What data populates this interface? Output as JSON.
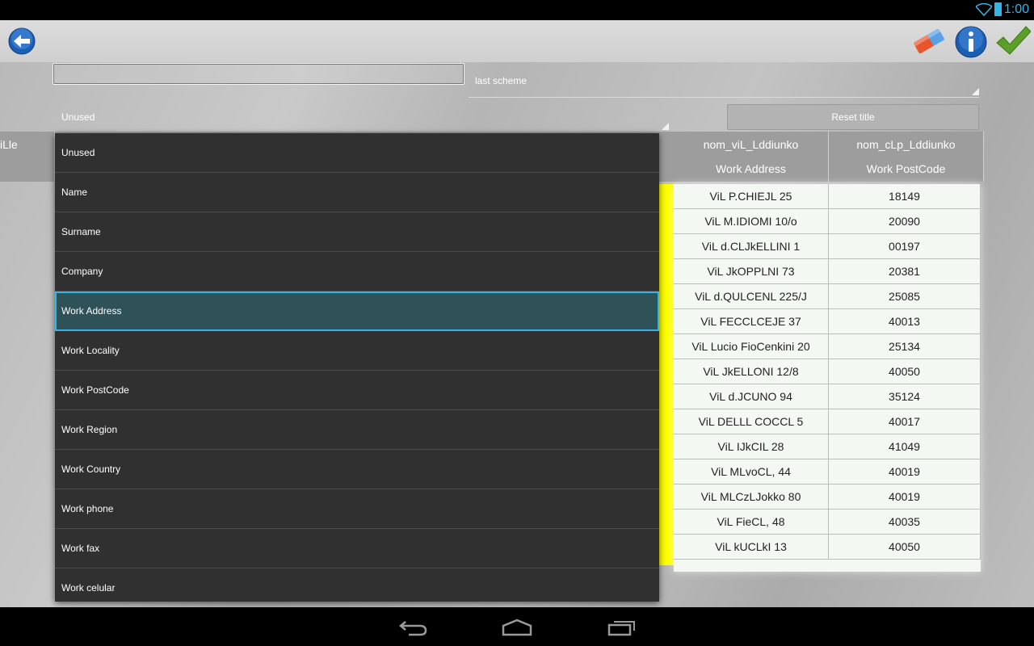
{
  "status_bar": {
    "time": "1:00",
    "accent_color": "#33b5e5"
  },
  "action_bar": {
    "back_icon": "back-arrow-icon",
    "eraser_icon": "eraser-icon",
    "info_icon": "info-icon",
    "confirm_icon": "checkmark-icon"
  },
  "title_input": {
    "value": ""
  },
  "scheme_spinner": {
    "value": "last scheme"
  },
  "reset_button": {
    "label": "Reset title"
  },
  "unused_spinner": {
    "value": "Unused"
  },
  "left_header": {
    "text": "iLle"
  },
  "table": {
    "columns": [
      {
        "header_source": "nom_viL_Lddiunko",
        "header_field": "Work Address"
      },
      {
        "header_source": "nom_cLp_Lddiunko",
        "header_field": "Work PostCode"
      }
    ],
    "rows": [
      [
        "ViL P.CHIEJL 25",
        "18149"
      ],
      [
        "ViL M.IDIOMI 10/o",
        "20090"
      ],
      [
        "ViL d.CLJkELLINI 1",
        "00197"
      ],
      [
        "ViL JkOPPLNI 73",
        "20381"
      ],
      [
        "ViL d.QULCENL 225/J",
        "25085"
      ],
      [
        "ViL FECCLCEJE 37",
        "40013"
      ],
      [
        "ViL Lucio FioCenkini 20",
        "25134"
      ],
      [
        "ViL JkELLONI 12/8",
        "40050"
      ],
      [
        "ViL d.JCUNO 94",
        "35124"
      ],
      [
        "ViL DELLL COCCL 5",
        "40017"
      ],
      [
        "ViL IJkCIL 28",
        "41049"
      ],
      [
        "ViL MLvoCL, 44",
        "40019"
      ],
      [
        "ViL MLCzLJokko 80",
        "40019"
      ],
      [
        "ViL FieCL, 48",
        "40035"
      ],
      [
        "ViL kUCLkI 13",
        "40050"
      ]
    ]
  },
  "dropdown": {
    "selected": "Work Address",
    "items": [
      "Unused",
      "Name",
      "Surname",
      "Company",
      "Work Address",
      "Work Locality",
      "Work PostCode",
      "Work Region",
      "Work Country",
      "Work phone",
      "Work fax",
      "Work celular"
    ]
  },
  "nav_bar": {
    "icons": [
      "back-icon",
      "home-icon",
      "recent-apps-icon"
    ]
  }
}
